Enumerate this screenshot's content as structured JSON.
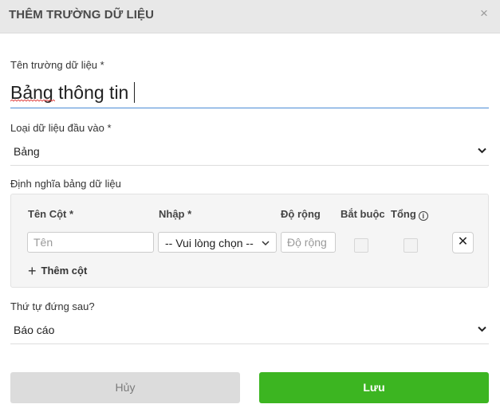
{
  "dialog": {
    "title": "THÊM TRƯỜNG DỮ LIỆU",
    "close_glyph": "×"
  },
  "field_name": {
    "label": "Tên trường dữ liệu *",
    "value": "Bảng thông tin"
  },
  "input_type": {
    "label": "Loại dữ liệu đầu vào *",
    "value": "Bảng"
  },
  "table_definition": {
    "label": "Định nghĩa bảng dữ liệu",
    "headers": {
      "name": "Tên Cột *",
      "type": "Nhập *",
      "width": "Độ rộng",
      "required": "Bắt buộc",
      "total": "Tổng"
    },
    "row": {
      "name_placeholder": "Tên",
      "type_value": "-- Vui lòng chọn --",
      "width_placeholder": "Độ rộng",
      "required_checked": false,
      "total_checked": false,
      "delete_glyph": "✕"
    },
    "add_column_plus": "+",
    "add_column_label": "Thêm cột",
    "info_glyph": "i"
  },
  "position_after": {
    "label": "Thứ tự đứng sau?",
    "value": "Báo cáo"
  },
  "actions": {
    "cancel_label": "Hủy",
    "save_label": "Lưu"
  },
  "colors": {
    "header_bg": "#e8e8e8",
    "save_green": "#3cb521",
    "cancel_gray": "#dcdcdc",
    "input_underline": "#4a8bd6"
  }
}
